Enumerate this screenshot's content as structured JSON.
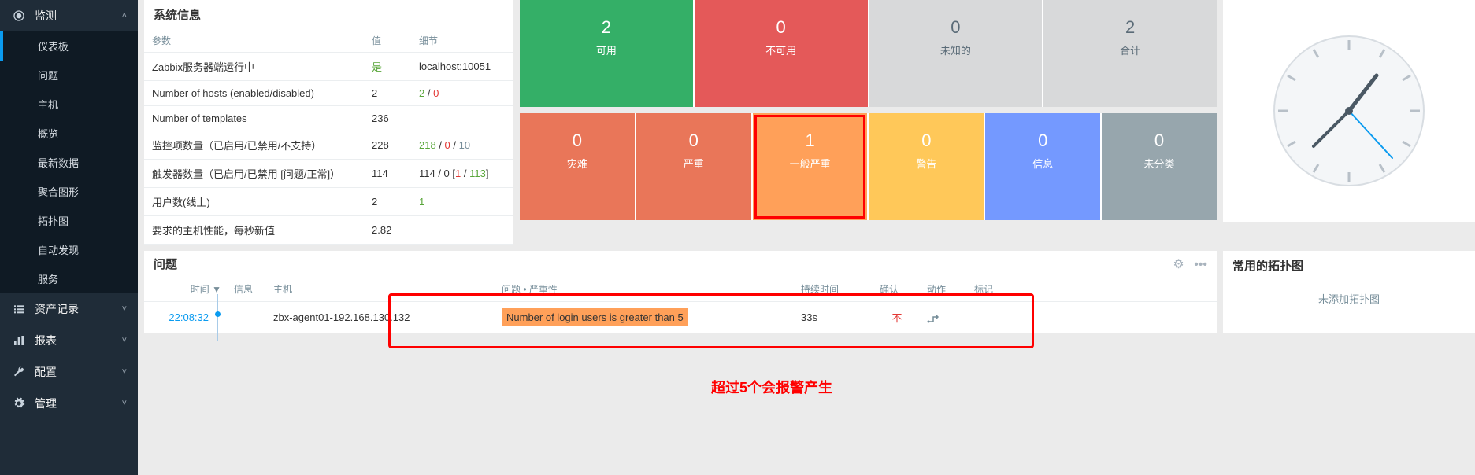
{
  "sidebar": {
    "sections": [
      {
        "icon": "eye",
        "title": "监测",
        "expanded": true,
        "items": [
          "仪表板",
          "问题",
          "主机",
          "概览",
          "最新数据",
          "聚合图形",
          "拓扑图",
          "自动发现",
          "服务"
        ],
        "selectedIndex": 0
      },
      {
        "icon": "list",
        "title": "资产记录",
        "expanded": false
      },
      {
        "icon": "bars",
        "title": "报表",
        "expanded": false
      },
      {
        "icon": "wrench",
        "title": "配置",
        "expanded": false
      },
      {
        "icon": "gear",
        "title": "管理",
        "expanded": false
      }
    ]
  },
  "sysinfo": {
    "title": "系统信息",
    "headers": {
      "param": "参数",
      "value": "值",
      "detail": "细节"
    },
    "rows": [
      {
        "param": "Zabbix服务器端运行中",
        "value": "是",
        "value_cls": "green",
        "detail": "localhost:10051"
      },
      {
        "param": "Number of hosts (enabled/disabled)",
        "value": "2",
        "detail_html": "<span class='green'>2</span> / <span class='red'>0</span>"
      },
      {
        "param": "Number of templates",
        "value": "236",
        "detail": ""
      },
      {
        "param": "监控项数量（已启用/已禁用/不支持）",
        "value": "228",
        "detail_html": "<span class='green'>218</span> / <span class='red'>0</span> / <span style='color:#768d99'>10</span>"
      },
      {
        "param": "触发器数量（已启用/已禁用 [问题/正常]）",
        "value": "114",
        "detail_html": "114 / 0 [<span class='red'>1</span> / <span class='green'>113</span>]"
      },
      {
        "param": "用户数(线上)",
        "value": "2",
        "detail_html": "<span class='green'>1</span>"
      },
      {
        "param": "要求的主机性能，每秒新值",
        "value": "2.82",
        "detail": ""
      }
    ]
  },
  "hostTiles": [
    {
      "num": "2",
      "lbl": "可用",
      "cls": "green-bg"
    },
    {
      "num": "0",
      "lbl": "不可用",
      "cls": "red-bg"
    },
    {
      "num": "0",
      "lbl": "未知的",
      "cls": "gray"
    },
    {
      "num": "2",
      "lbl": "合计",
      "cls": "gray"
    }
  ],
  "sevTiles": [
    {
      "num": "0",
      "lbl": "灾难",
      "cls": "t-red"
    },
    {
      "num": "0",
      "lbl": "严重",
      "cls": "t-red"
    },
    {
      "num": "1",
      "lbl": "一般严重",
      "cls": "t-orange",
      "hl": true
    },
    {
      "num": "0",
      "lbl": "警告",
      "cls": "t-yellow"
    },
    {
      "num": "0",
      "lbl": "信息",
      "cls": "t-blue"
    },
    {
      "num": "0",
      "lbl": "未分类",
      "cls": "t-ltgray"
    }
  ],
  "problems": {
    "title": "问题",
    "headers": [
      "时间 ▼",
      "信息",
      "主机",
      "问题 • 严重性",
      "持续时间",
      "确认",
      "动作",
      "标记"
    ],
    "row": {
      "time": "22:08:32",
      "host": "zbx-agent01-192.168.130.132",
      "problem": "Number of login users is greater than 5",
      "duration": "33s",
      "ack": "不"
    },
    "annotation": "超过5个会报警产生"
  },
  "maps": {
    "title": "常用的拓扑图",
    "empty": "未添加拓扑图"
  }
}
